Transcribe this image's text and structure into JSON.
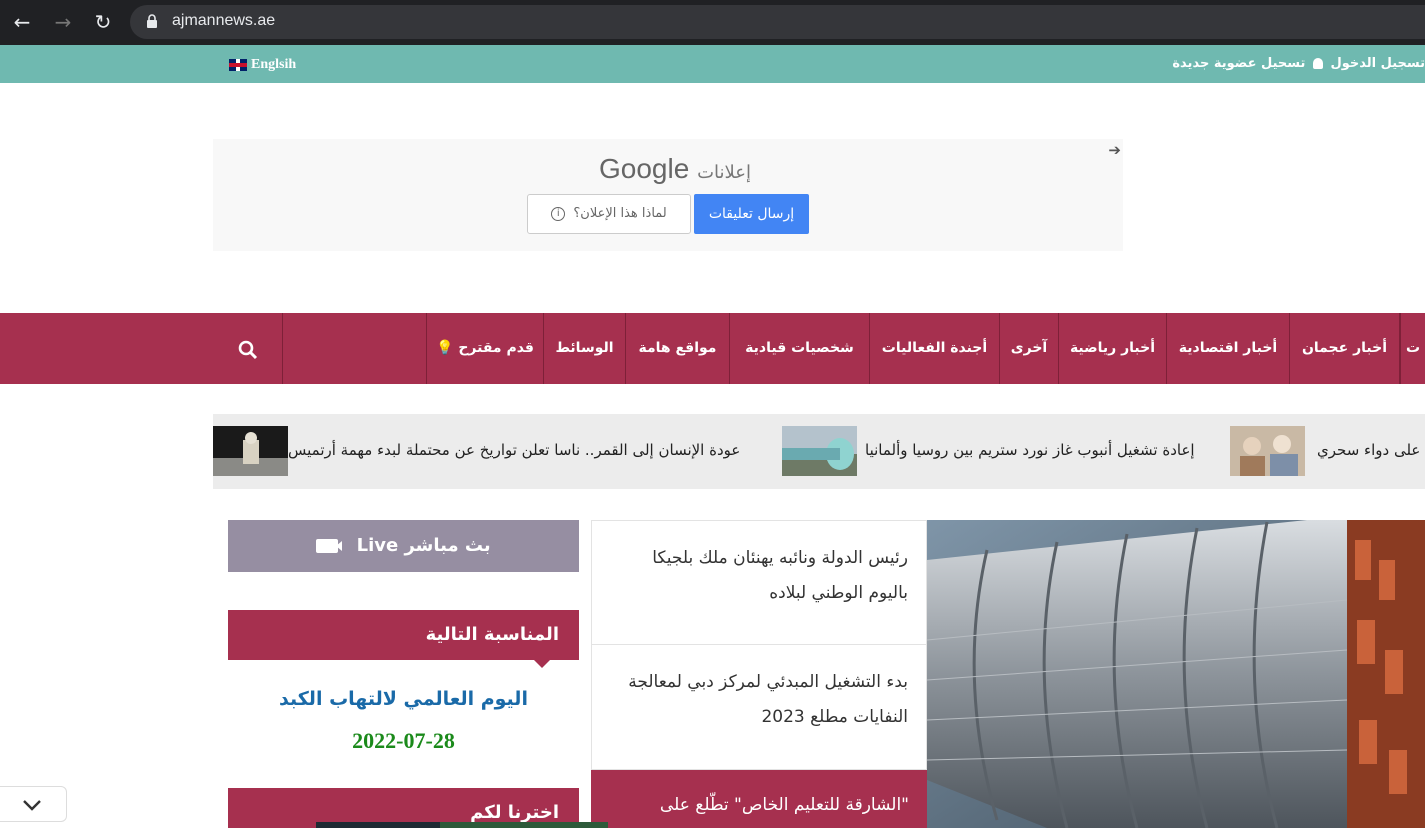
{
  "browser": {
    "url": "ajmannews.ae",
    "back_icon": "arrow-left-icon",
    "forward_icon": "arrow-right-icon",
    "reload_icon": "reload-icon"
  },
  "topbar": {
    "language_label": "Englsih",
    "login_label": "تسجيل الدخول",
    "register_label": "تسحيل عضوية جديدة"
  },
  "ad": {
    "brand": "Google",
    "ads_label": "إعلانات",
    "why_label": "لماذا هذا الإعلان؟",
    "send_feedback_label": "إرسال تعليقات"
  },
  "nav": {
    "items": [
      {
        "label": "ت"
      },
      {
        "label": "أخبار عجمان"
      },
      {
        "label": "أخبار اقتصادية"
      },
      {
        "label": "أخبار رياضية"
      },
      {
        "label": "آخرى"
      },
      {
        "label": "أجندة الفعاليات"
      },
      {
        "label": "شخصيات قيادية"
      },
      {
        "label": "مواقع هامة"
      },
      {
        "label": "الوسائط"
      },
      {
        "label": "قدم مقترح"
      }
    ]
  },
  "ticker": {
    "items": [
      {
        "text": "على دواء سحري"
      },
      {
        "text": "إعادة تشغيل أنبوب غاز نورد ستريم بين روسيا وألمانيا"
      },
      {
        "text": "عودة الإنسان إلى القمر.. ناسا تعلن تواريخ عن محتملة لبدء مهمة أرتميس"
      }
    ]
  },
  "sidebar": {
    "live_label": "بث مباشر Live",
    "next_occasion_heading": "المناسبة التالية",
    "occasion_title": "اليوم العالمي لالتهاب الكبد",
    "occasion_date": "2022-07-28",
    "chosen_heading": "اخترنا لكم"
  },
  "news": [
    {
      "title": "رئيس الدولة ونائبه يهنئان ملك بلجيكا باليوم الوطني لبلاده"
    },
    {
      "title": "بدء التشغيل المبدئي لمركز دبي لمعالجة النفايات مطلع 2023"
    },
    {
      "title": "\"الشارقة للتعليم الخاص\" تطّلع على"
    }
  ],
  "colors": {
    "topbar": "#6fb9b0",
    "nav": "#a6304f",
    "live": "#968ea2",
    "occasion_title": "#1a6aa8",
    "occasion_date": "#1b8a1b"
  }
}
